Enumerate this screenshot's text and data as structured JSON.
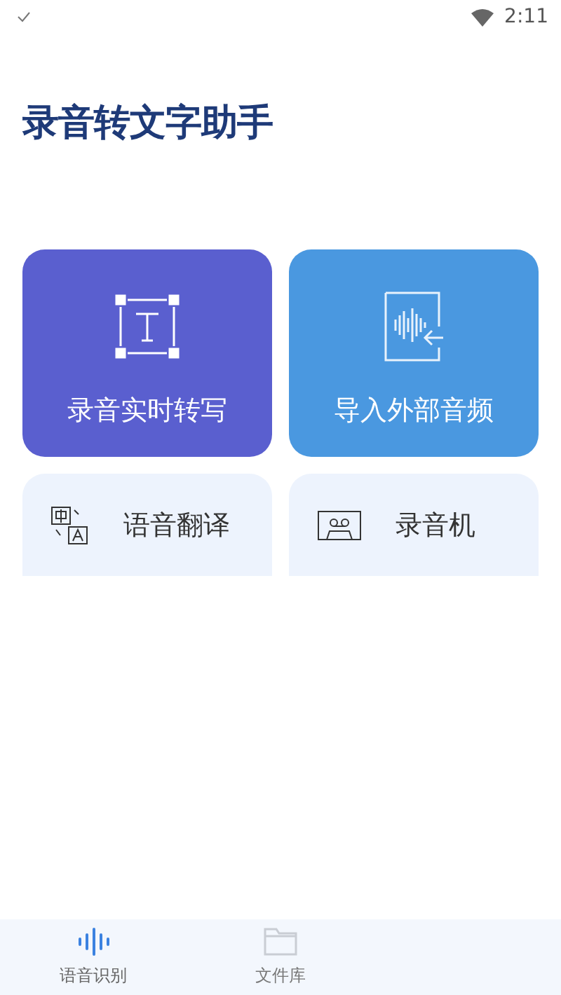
{
  "status_bar": {
    "time": "2:11"
  },
  "title": "录音转文字助手",
  "feature_cards": [
    {
      "kind": "large",
      "label": "录音实时转写",
      "color": "#5a5fcf"
    },
    {
      "kind": "large",
      "label": "导入外部音频",
      "color": "#4a98e0"
    },
    {
      "kind": "small",
      "label": "语音翻译"
    },
    {
      "kind": "small",
      "label": "录音机"
    }
  ],
  "tabs": [
    {
      "label": "语音识别",
      "selected": true
    },
    {
      "label": "文件库",
      "selected": false
    }
  ]
}
